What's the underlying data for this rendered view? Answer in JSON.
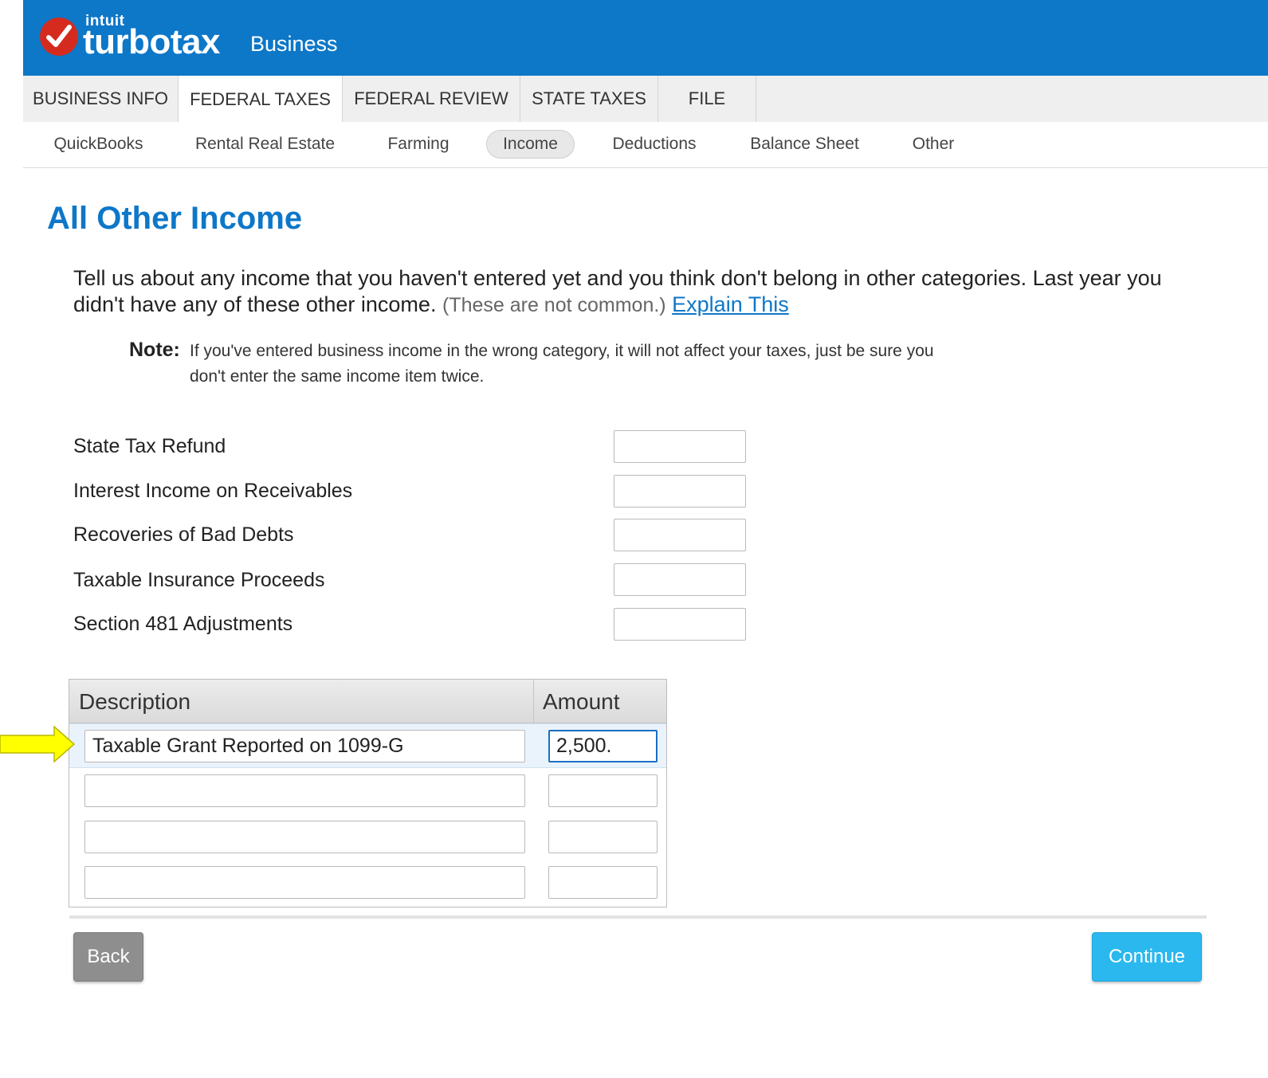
{
  "brand": {
    "intuit": "intuit",
    "product": "turbotax",
    "edition": "Business"
  },
  "main_tabs": [
    {
      "label": "BUSINESS INFO",
      "active": false
    },
    {
      "label": "FEDERAL TAXES",
      "active": true
    },
    {
      "label": "FEDERAL REVIEW",
      "active": false
    },
    {
      "label": "STATE TAXES",
      "active": false
    },
    {
      "label": "FILE",
      "active": false
    }
  ],
  "sub_tabs": [
    {
      "label": "QuickBooks",
      "active": false
    },
    {
      "label": "Rental Real Estate",
      "active": false
    },
    {
      "label": "Farming",
      "active": false
    },
    {
      "label": "Income",
      "active": true
    },
    {
      "label": "Deductions",
      "active": false
    },
    {
      "label": "Balance Sheet",
      "active": false
    },
    {
      "label": "Other",
      "active": false
    }
  ],
  "page": {
    "title": "All Other Income",
    "intro": "Tell us about any income that you haven't entered yet and you think don't belong in other categories. Last year you didn't have any of these other income.",
    "intro_muted": "(These are not common.)",
    "explain_link": "Explain This",
    "note_label": "Note:",
    "note_text": "If you've entered business income in the wrong category, it will not affect your taxes, just be sure you don't enter the same income item twice."
  },
  "fields": [
    {
      "label": "State Tax Refund",
      "value": ""
    },
    {
      "label": "Interest Income on Receivables",
      "value": ""
    },
    {
      "label": "Recoveries of Bad Debts",
      "value": ""
    },
    {
      "label": "Taxable Insurance Proceeds",
      "value": ""
    },
    {
      "label": "Section 481 Adjustments",
      "value": ""
    }
  ],
  "other_income_table": {
    "columns": [
      "Description",
      "Amount"
    ],
    "rows": [
      {
        "description": "Taxable Grant Reported on 1099-G",
        "amount": "2,500.",
        "selected": true
      },
      {
        "description": "",
        "amount": "",
        "selected": false
      },
      {
        "description": "",
        "amount": "",
        "selected": false
      },
      {
        "description": "",
        "amount": "",
        "selected": false
      }
    ]
  },
  "buttons": {
    "back": "Back",
    "continue": "Continue"
  },
  "colors": {
    "brand_blue": "#0d77c8",
    "continue_blue": "#2ab8ef",
    "back_gray": "#8e8e8e",
    "arrow_yellow": "#ffff00"
  },
  "icons": {
    "logo": "turbotax-checkmark-logo",
    "pointer": "yellow-arrow-icon"
  }
}
